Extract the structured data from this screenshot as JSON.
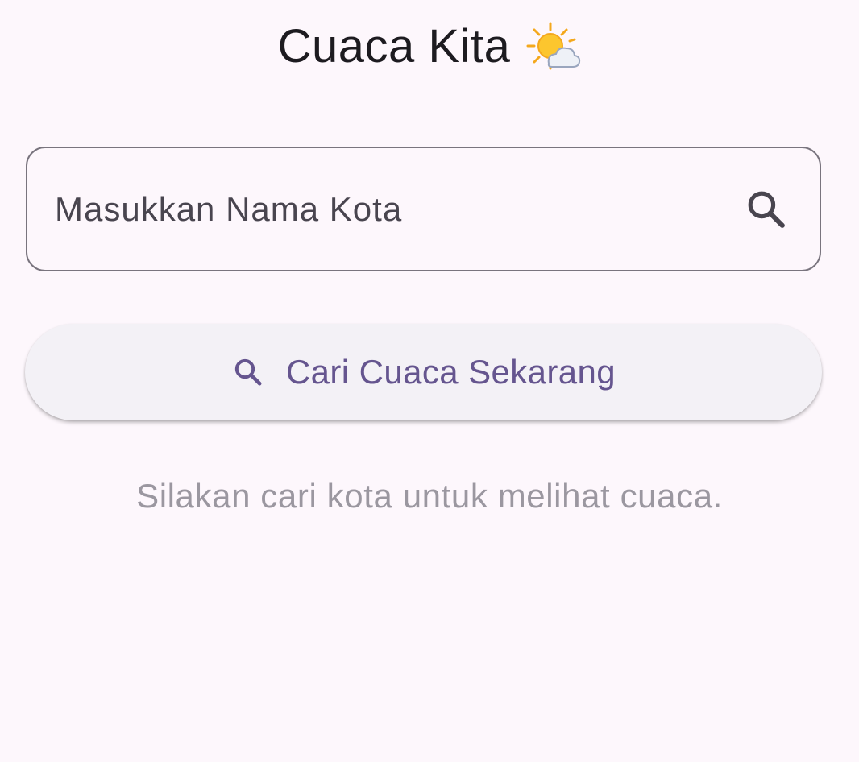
{
  "app": {
    "title": "Cuaca Kita",
    "title_icon": "sun-behind-cloud-icon"
  },
  "search": {
    "placeholder": "Masukkan Nama Kota",
    "value": "",
    "icon": "search-icon"
  },
  "actions": {
    "search_button_label": "Cari Cuaca Sekarang",
    "search_button_icon": "search-icon"
  },
  "status": {
    "empty_message": "Silakan cari kota untuk melihat cuaca."
  },
  "colors": {
    "background": "#fdf7fc",
    "primary": "#65558f",
    "outline": "#79747e",
    "on_surface": "#1d1b20",
    "on_surface_variant": "#49454f",
    "button_surface": "#f3f1f6"
  }
}
